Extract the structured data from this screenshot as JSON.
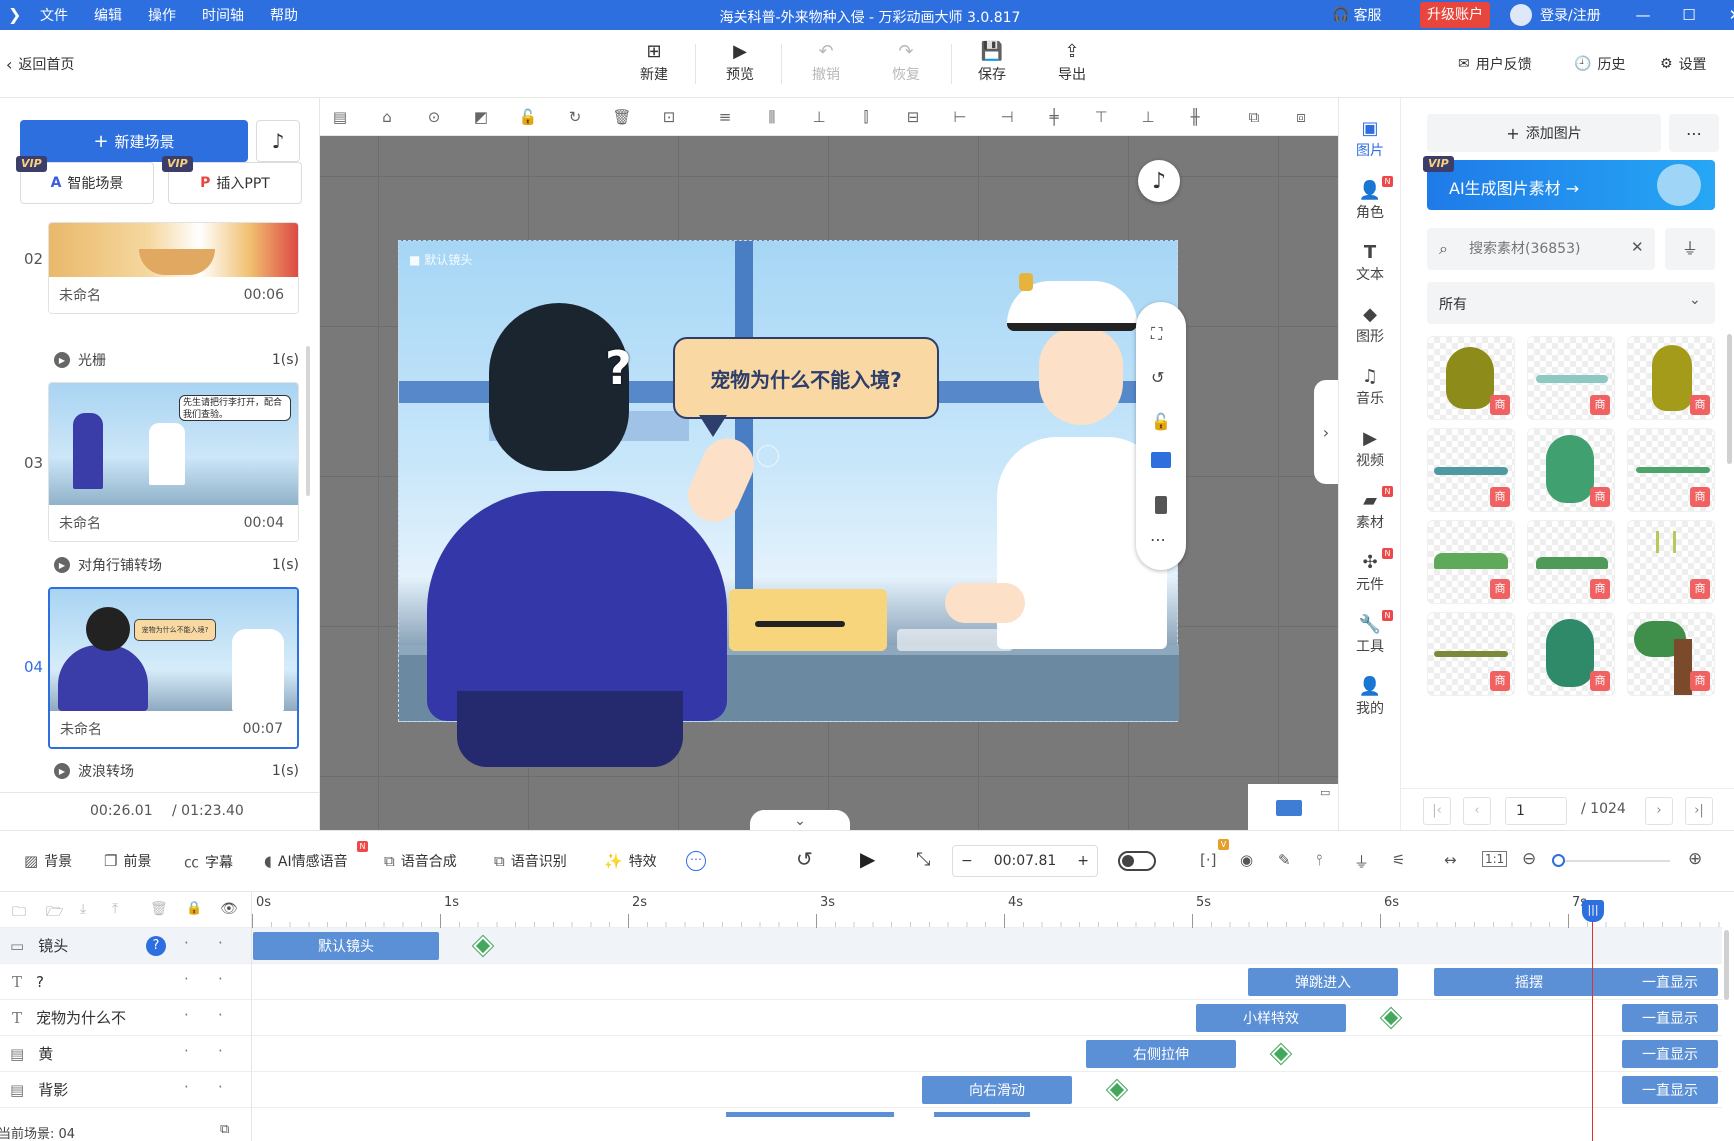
{
  "titlebar": {
    "menu": [
      "文件",
      "编辑",
      "操作",
      "时间轴",
      "帮助"
    ],
    "title": "海关科普-外来物种入侵 - 万彩动画大师 3.0.817",
    "service": "客服",
    "upgrade": "升级账户",
    "login": "登录/注册"
  },
  "toolbar": {
    "back": "返回首页",
    "new": "新建",
    "preview": "预览",
    "undo": "撤销",
    "redo": "恢复",
    "save": "保存",
    "export": "导出",
    "feedback": "用户反馈",
    "history": "历史",
    "settings": "设置"
  },
  "left": {
    "new_scene": "新建场景",
    "smart_scene": "智能场景",
    "insert_ppt": "插入PPT",
    "vip": "VIP",
    "scenes": [
      {
        "num": "02",
        "name": "未命名",
        "time": "00:06"
      },
      {
        "num": "03",
        "name": "未命名",
        "time": "00:04",
        "bubble": "先生请把行李打开，配合我们查验。"
      },
      {
        "num": "04",
        "name": "未命名",
        "time": "00:07",
        "bubble": "宠物为什么不能入境?"
      }
    ],
    "transitions": [
      {
        "name": "光栅",
        "dur": "1(s)"
      },
      {
        "name": "对角行铺转场",
        "dur": "1(s)"
      },
      {
        "name": "波浪转场",
        "dur": "1(s)"
      }
    ],
    "time_current": "00:26.01",
    "time_total": "/ 01:23.40"
  },
  "canvas": {
    "camera_label": "默认镜头",
    "speech": "宠物为什么不能入境?"
  },
  "rail": [
    "图片",
    "角色",
    "文本",
    "图形",
    "音乐",
    "视频",
    "素材",
    "元件",
    "工具",
    "我的"
  ],
  "materials": {
    "add_image": "添加图片",
    "ai_banner": "AI生成图片素材 →",
    "search_placeholder": "搜索素材(36853)",
    "filter_all": "所有",
    "tag": "商",
    "page": "1",
    "page_total": "/ 1024"
  },
  "bottom": {
    "tools": [
      "背景",
      "前景",
      "字幕",
      "AI情感语音",
      "语音合成",
      "语音识别",
      "特效"
    ],
    "time": "00:07.81"
  },
  "timeline": {
    "ticks": [
      "0s",
      "1s",
      "2s",
      "3s",
      "4s",
      "5s",
      "6s",
      "7s"
    ],
    "layers": [
      {
        "name": "镜头",
        "clips": [
          {
            "label": "默认镜头"
          }
        ]
      },
      {
        "name": "?",
        "clips": [
          {
            "label": "弹跳进入"
          },
          {
            "label": "摇摆"
          },
          {
            "label": "一直显示"
          }
        ]
      },
      {
        "name": "宠物为什么不",
        "clips": [
          {
            "label": "小样特效"
          },
          {
            "label": "一直显示"
          }
        ]
      },
      {
        "name": "黄",
        "clips": [
          {
            "label": "右侧拉伸"
          },
          {
            "label": "一直显示"
          }
        ]
      },
      {
        "name": "背影",
        "clips": [
          {
            "label": "向右滑动"
          },
          {
            "label": "一直显示"
          }
        ]
      }
    ],
    "current_scene": "当前场景: 04"
  },
  "colors": {
    "accent": "#2e6fe0",
    "clip": "#5b8fd6",
    "keyframe": "#43a85c",
    "playhead": "#e03030"
  }
}
